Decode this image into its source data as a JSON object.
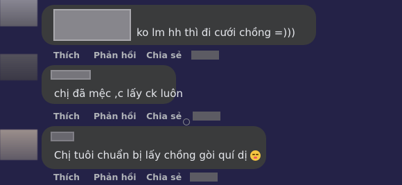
{
  "comments": [
    {
      "text": "ko lm hh thì đi cưới chồng =)))",
      "actions": {
        "like": "Thích",
        "reply": "Phản hồi",
        "share": "Chia sẻ"
      }
    },
    {
      "text": "chị đã mệc ,c lấy ck luôn",
      "actions": {
        "like": "Thích",
        "reply": "Phản hồi",
        "share": "Chia sẻ"
      }
    },
    {
      "text": "Chị tuôi chuẩn bị lấy chồng gòi quí dị",
      "emoji": "tired-face-emoji",
      "actions": {
        "like": "Thích",
        "reply": "Phản hồi",
        "share": "Chia sẻ"
      }
    }
  ]
}
